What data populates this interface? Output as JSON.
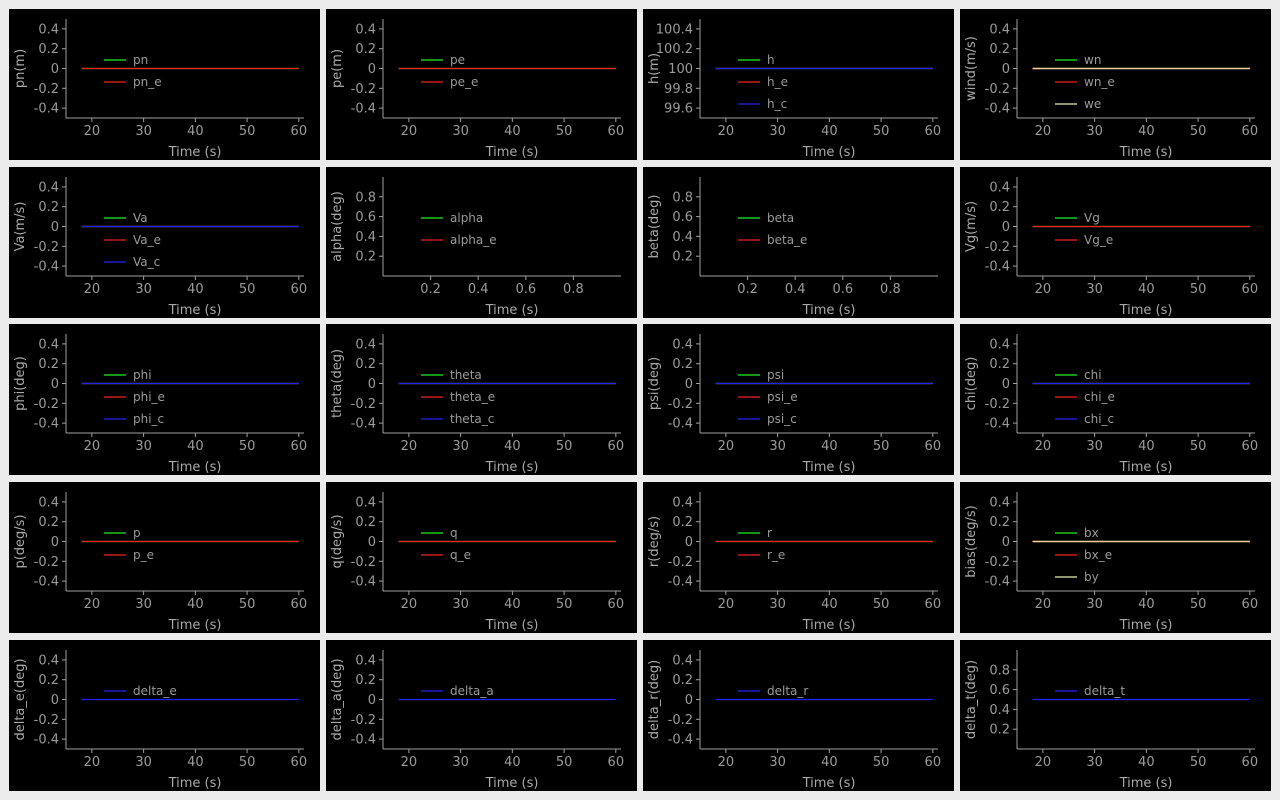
{
  "theme": {
    "background": "#000000",
    "frame": "#ececec",
    "axis": "#a0a0a0",
    "text": "#9a9a9a",
    "colors": {
      "green": "#22ee22",
      "red": "#ee2222",
      "blue": "#2222ee",
      "peach": "#ffc8a0",
      "pale": "#e8f0b0"
    }
  },
  "chart_data": [
    {
      "type": "line",
      "ylabel": "pn(m)",
      "xlabel": "Time (s)",
      "xlim": [
        15,
        61
      ],
      "ylim": [
        -0.5,
        0.5
      ],
      "xticks": [
        "20",
        "30",
        "40",
        "50",
        "60"
      ],
      "yticks": [
        "-0.4",
        "-0.2",
        "0",
        "0.2",
        "0.4"
      ],
      "series": [
        {
          "name": "pn",
          "color": "#22ee22",
          "x": [
            18,
            60
          ],
          "y": [
            0,
            0
          ]
        },
        {
          "name": "pn_e",
          "color": "#ee2222",
          "x": [
            18,
            60
          ],
          "y": [
            0,
            0
          ]
        }
      ]
    },
    {
      "type": "line",
      "ylabel": "pe(m)",
      "xlabel": "Time (s)",
      "xlim": [
        15,
        61
      ],
      "ylim": [
        -0.5,
        0.5
      ],
      "xticks": [
        "20",
        "30",
        "40",
        "50",
        "60"
      ],
      "yticks": [
        "-0.4",
        "-0.2",
        "0",
        "0.2",
        "0.4"
      ],
      "series": [
        {
          "name": "pe",
          "color": "#22ee22",
          "x": [
            18,
            60
          ],
          "y": [
            0,
            0
          ]
        },
        {
          "name": "pe_e",
          "color": "#ee2222",
          "x": [
            18,
            60
          ],
          "y": [
            0,
            0
          ]
        }
      ]
    },
    {
      "type": "line",
      "ylabel": "h(m)",
      "xlabel": "Time (s)",
      "xlim": [
        15,
        61
      ],
      "ylim": [
        99.5,
        100.5
      ],
      "xticks": [
        "20",
        "30",
        "40",
        "50",
        "60"
      ],
      "yticks": [
        "99.6",
        "99.8",
        "100",
        "100.2",
        "100.4"
      ],
      "series": [
        {
          "name": "h",
          "color": "#22ee22",
          "x": [
            18,
            60
          ],
          "y": [
            100,
            100
          ]
        },
        {
          "name": "h_e",
          "color": "#ee2222",
          "x": [
            18,
            60
          ],
          "y": [
            100,
            100
          ]
        },
        {
          "name": "h_c",
          "color": "#2222ee",
          "x": [
            18,
            60
          ],
          "y": [
            100,
            100
          ]
        }
      ]
    },
    {
      "type": "line",
      "ylabel": "wind(m/s)",
      "xlabel": "Time (s)",
      "xlim": [
        15,
        61
      ],
      "ylim": [
        -0.5,
        0.5
      ],
      "xticks": [
        "20",
        "30",
        "40",
        "50",
        "60"
      ],
      "yticks": [
        "-0.4",
        "-0.2",
        "0",
        "0.2",
        "0.4"
      ],
      "series": [
        {
          "name": "wn",
          "color": "#22ee22",
          "x": [
            18,
            60
          ],
          "y": [
            0,
            0
          ]
        },
        {
          "name": "wn_e",
          "color": "#ee2222",
          "x": [
            18,
            60
          ],
          "y": [
            0,
            0
          ]
        },
        {
          "name": "we",
          "color": "#e8f0b0",
          "x": [
            18,
            60
          ],
          "y": [
            0,
            0
          ]
        },
        {
          "name": "",
          "color": "#ffc8a0",
          "x": [
            18,
            60
          ],
          "y": [
            0,
            0
          ]
        }
      ]
    },
    {
      "type": "line",
      "ylabel": "Va(m/s)",
      "xlabel": "Time (s)",
      "xlim": [
        15,
        61
      ],
      "ylim": [
        -0.5,
        0.5
      ],
      "xticks": [
        "20",
        "30",
        "40",
        "50",
        "60"
      ],
      "yticks": [
        "-0.4",
        "-0.2",
        "0",
        "0.2",
        "0.4"
      ],
      "series": [
        {
          "name": "Va",
          "color": "#22ee22",
          "x": [
            18,
            60
          ],
          "y": [
            0,
            0
          ]
        },
        {
          "name": "Va_e",
          "color": "#ee2222",
          "x": [
            18,
            60
          ],
          "y": [
            0,
            0
          ]
        },
        {
          "name": "Va_c",
          "color": "#2222ee",
          "x": [
            18,
            60
          ],
          "y": [
            0,
            0
          ]
        }
      ]
    },
    {
      "type": "line",
      "ylabel": "alpha(deg)",
      "xlabel": "Time (s)",
      "xlim": [
        0,
        1
      ],
      "ylim": [
        0,
        1
      ],
      "xticks": [
        "0.2",
        "0.4",
        "0.6",
        "0.8"
      ],
      "yticks": [
        "0.2",
        "0.4",
        "0.6",
        "0.8"
      ],
      "series": [
        {
          "name": "alpha",
          "color": "#22ee22",
          "x": [],
          "y": []
        },
        {
          "name": "alpha_e",
          "color": "#ee2222",
          "x": [],
          "y": []
        }
      ]
    },
    {
      "type": "line",
      "ylabel": "beta(deg)",
      "xlabel": "Time (s)",
      "xlim": [
        0,
        1
      ],
      "ylim": [
        0,
        1
      ],
      "xticks": [
        "0.2",
        "0.4",
        "0.6",
        "0.8"
      ],
      "yticks": [
        "0.2",
        "0.4",
        "0.6",
        "0.8"
      ],
      "series": [
        {
          "name": "beta",
          "color": "#22ee22",
          "x": [],
          "y": []
        },
        {
          "name": "beta_e",
          "color": "#ee2222",
          "x": [],
          "y": []
        }
      ]
    },
    {
      "type": "line",
      "ylabel": "Vg(m/s)",
      "xlabel": "Time (s)",
      "xlim": [
        15,
        61
      ],
      "ylim": [
        -0.5,
        0.5
      ],
      "xticks": [
        "20",
        "30",
        "40",
        "50",
        "60"
      ],
      "yticks": [
        "-0.4",
        "-0.2",
        "0",
        "0.2",
        "0.4"
      ],
      "series": [
        {
          "name": "Vg",
          "color": "#22ee22",
          "x": [
            18,
            60
          ],
          "y": [
            0,
            0
          ]
        },
        {
          "name": "Vg_e",
          "color": "#ee2222",
          "x": [
            18,
            60
          ],
          "y": [
            0,
            0
          ]
        }
      ]
    },
    {
      "type": "line",
      "ylabel": "phi(deg)",
      "xlabel": "Time (s)",
      "xlim": [
        15,
        61
      ],
      "ylim": [
        -0.5,
        0.5
      ],
      "xticks": [
        "20",
        "30",
        "40",
        "50",
        "60"
      ],
      "yticks": [
        "-0.4",
        "-0.2",
        "0",
        "0.2",
        "0.4"
      ],
      "series": [
        {
          "name": "phi",
          "color": "#22ee22",
          "x": [
            18,
            60
          ],
          "y": [
            0,
            0
          ]
        },
        {
          "name": "phi_e",
          "color": "#ee2222",
          "x": [
            18,
            60
          ],
          "y": [
            0,
            0
          ]
        },
        {
          "name": "phi_c",
          "color": "#2222ee",
          "x": [
            18,
            60
          ],
          "y": [
            0,
            0
          ]
        }
      ]
    },
    {
      "type": "line",
      "ylabel": "theta(deg)",
      "xlabel": "Time (s)",
      "xlim": [
        15,
        61
      ],
      "ylim": [
        -0.5,
        0.5
      ],
      "xticks": [
        "20",
        "30",
        "40",
        "50",
        "60"
      ],
      "yticks": [
        "-0.4",
        "-0.2",
        "0",
        "0.2",
        "0.4"
      ],
      "series": [
        {
          "name": "theta",
          "color": "#22ee22",
          "x": [
            18,
            60
          ],
          "y": [
            0,
            0
          ]
        },
        {
          "name": "theta_e",
          "color": "#ee2222",
          "x": [
            18,
            60
          ],
          "y": [
            0,
            0
          ]
        },
        {
          "name": "theta_c",
          "color": "#2222ee",
          "x": [
            18,
            60
          ],
          "y": [
            0,
            0
          ]
        }
      ]
    },
    {
      "type": "line",
      "ylabel": "psi(deg)",
      "xlabel": "Time (s)",
      "xlim": [
        15,
        61
      ],
      "ylim": [
        -0.5,
        0.5
      ],
      "xticks": [
        "20",
        "30",
        "40",
        "50",
        "60"
      ],
      "yticks": [
        "-0.4",
        "-0.2",
        "0",
        "0.2",
        "0.4"
      ],
      "series": [
        {
          "name": "psi",
          "color": "#22ee22",
          "x": [
            18,
            60
          ],
          "y": [
            0,
            0
          ]
        },
        {
          "name": "psi_e",
          "color": "#ee2222",
          "x": [
            18,
            60
          ],
          "y": [
            0,
            0
          ]
        },
        {
          "name": "psi_c",
          "color": "#2222ee",
          "x": [
            18,
            60
          ],
          "y": [
            0,
            0
          ]
        }
      ]
    },
    {
      "type": "line",
      "ylabel": "chi(deg)",
      "xlabel": "Time (s)",
      "xlim": [
        15,
        61
      ],
      "ylim": [
        -0.5,
        0.5
      ],
      "xticks": [
        "20",
        "30",
        "40",
        "50",
        "60"
      ],
      "yticks": [
        "-0.4",
        "-0.2",
        "0",
        "0.2",
        "0.4"
      ],
      "series": [
        {
          "name": "chi",
          "color": "#22ee22",
          "x": [
            18,
            60
          ],
          "y": [
            0,
            0
          ]
        },
        {
          "name": "chi_e",
          "color": "#ee2222",
          "x": [
            18,
            60
          ],
          "y": [
            0,
            0
          ]
        },
        {
          "name": "chi_c",
          "color": "#2222ee",
          "x": [
            18,
            60
          ],
          "y": [
            0,
            0
          ]
        }
      ]
    },
    {
      "type": "line",
      "ylabel": "p(deg/s)",
      "xlabel": "Time (s)",
      "xlim": [
        15,
        61
      ],
      "ylim": [
        -0.5,
        0.5
      ],
      "xticks": [
        "20",
        "30",
        "40",
        "50",
        "60"
      ],
      "yticks": [
        "-0.4",
        "-0.2",
        "0",
        "0.2",
        "0.4"
      ],
      "series": [
        {
          "name": "p",
          "color": "#22ee22",
          "x": [
            18,
            60
          ],
          "y": [
            0,
            0
          ]
        },
        {
          "name": "p_e",
          "color": "#ee2222",
          "x": [
            18,
            60
          ],
          "y": [
            0,
            0
          ]
        }
      ]
    },
    {
      "type": "line",
      "ylabel": "q(deg/s)",
      "xlabel": "Time (s)",
      "xlim": [
        15,
        61
      ],
      "ylim": [
        -0.5,
        0.5
      ],
      "xticks": [
        "20",
        "30",
        "40",
        "50",
        "60"
      ],
      "yticks": [
        "-0.4",
        "-0.2",
        "0",
        "0.2",
        "0.4"
      ],
      "series": [
        {
          "name": "q",
          "color": "#22ee22",
          "x": [
            18,
            60
          ],
          "y": [
            0,
            0
          ]
        },
        {
          "name": "q_e",
          "color": "#ee2222",
          "x": [
            18,
            60
          ],
          "y": [
            0,
            0
          ]
        }
      ]
    },
    {
      "type": "line",
      "ylabel": "r(deg/s)",
      "xlabel": "Time (s)",
      "xlim": [
        15,
        61
      ],
      "ylim": [
        -0.5,
        0.5
      ],
      "xticks": [
        "20",
        "30",
        "40",
        "50",
        "60"
      ],
      "yticks": [
        "-0.4",
        "-0.2",
        "0",
        "0.2",
        "0.4"
      ],
      "series": [
        {
          "name": "r",
          "color": "#22ee22",
          "x": [
            18,
            60
          ],
          "y": [
            0,
            0
          ]
        },
        {
          "name": "r_e",
          "color": "#ee2222",
          "x": [
            18,
            60
          ],
          "y": [
            0,
            0
          ]
        }
      ]
    },
    {
      "type": "line",
      "ylabel": "bias(deg/s)",
      "xlabel": "Time (s)",
      "xlim": [
        15,
        61
      ],
      "ylim": [
        -0.5,
        0.5
      ],
      "xticks": [
        "20",
        "30",
        "40",
        "50",
        "60"
      ],
      "yticks": [
        "-0.4",
        "-0.2",
        "0",
        "0.2",
        "0.4"
      ],
      "series": [
        {
          "name": "bx",
          "color": "#22ee22",
          "x": [
            18,
            60
          ],
          "y": [
            0,
            0
          ]
        },
        {
          "name": "bx_e",
          "color": "#ee2222",
          "x": [
            18,
            60
          ],
          "y": [
            0,
            0
          ]
        },
        {
          "name": "by",
          "color": "#e8f0b0",
          "x": [
            18,
            60
          ],
          "y": [
            0,
            0
          ]
        },
        {
          "name": "",
          "color": "#ffc8a0",
          "x": [
            18,
            60
          ],
          "y": [
            0,
            0
          ]
        }
      ]
    },
    {
      "type": "line",
      "ylabel": "delta_e(deg)",
      "xlabel": "Time (s)",
      "xlim": [
        15,
        61
      ],
      "ylim": [
        -0.5,
        0.5
      ],
      "xticks": [
        "20",
        "30",
        "40",
        "50",
        "60"
      ],
      "yticks": [
        "-0.4",
        "-0.2",
        "0",
        "0.2",
        "0.4"
      ],
      "series": [
        {
          "name": "delta_e",
          "color": "#2222ee",
          "x": [
            18,
            60
          ],
          "y": [
            0,
            0
          ]
        }
      ]
    },
    {
      "type": "line",
      "ylabel": "delta_a(deg)",
      "xlabel": "Time (s)",
      "xlim": [
        15,
        61
      ],
      "ylim": [
        -0.5,
        0.5
      ],
      "xticks": [
        "20",
        "30",
        "40",
        "50",
        "60"
      ],
      "yticks": [
        "-0.4",
        "-0.2",
        "0",
        "0.2",
        "0.4"
      ],
      "series": [
        {
          "name": "delta_a",
          "color": "#2222ee",
          "x": [
            18,
            60
          ],
          "y": [
            0,
            0
          ]
        }
      ]
    },
    {
      "type": "line",
      "ylabel": "delta_r(deg)",
      "xlabel": "Time (s)",
      "xlim": [
        15,
        61
      ],
      "ylim": [
        -0.5,
        0.5
      ],
      "xticks": [
        "20",
        "30",
        "40",
        "50",
        "60"
      ],
      "yticks": [
        "-0.4",
        "-0.2",
        "0",
        "0.2",
        "0.4"
      ],
      "series": [
        {
          "name": "delta_r",
          "color": "#2222ee",
          "x": [
            18,
            60
          ],
          "y": [
            0,
            0
          ]
        }
      ]
    },
    {
      "type": "line",
      "ylabel": "delta_t(deg)",
      "xlabel": "Time (s)",
      "xlim": [
        15,
        61
      ],
      "ylim": [
        0,
        1
      ],
      "xticks": [
        "20",
        "30",
        "40",
        "50",
        "60"
      ],
      "yticks": [
        "0.2",
        "0.4",
        "0.6",
        "0.8"
      ],
      "series": [
        {
          "name": "delta_t",
          "color": "#2222ee",
          "x": [
            18,
            60
          ],
          "y": [
            0.5,
            0.5
          ]
        }
      ]
    }
  ]
}
